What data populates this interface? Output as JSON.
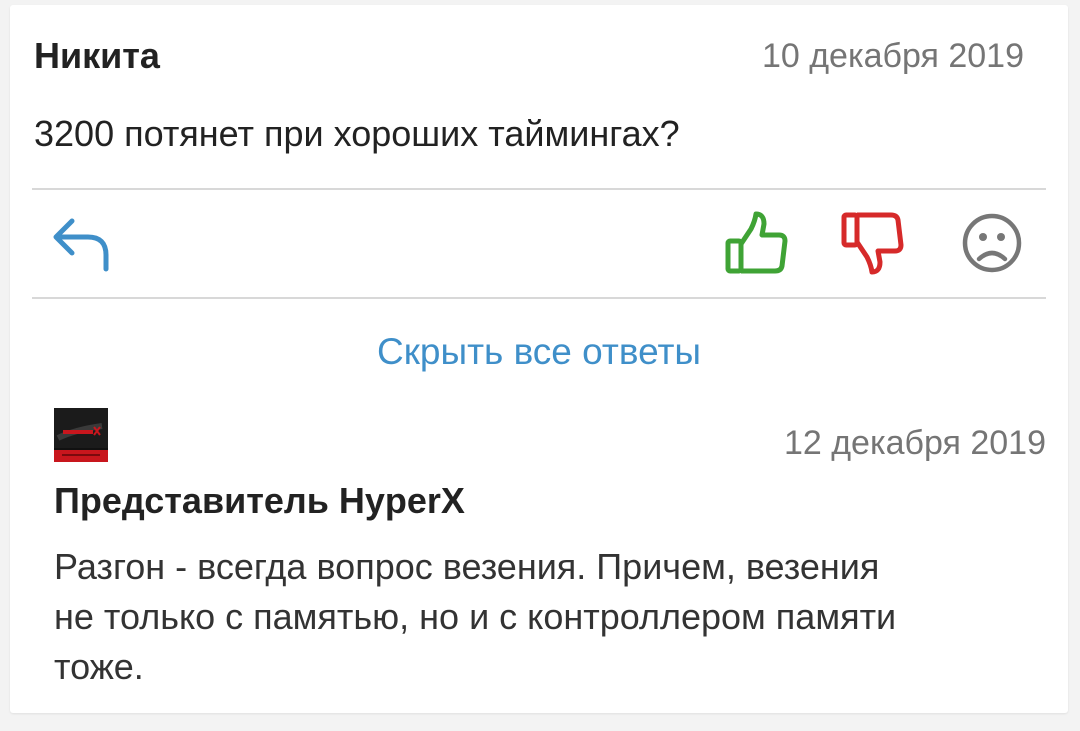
{
  "comment": {
    "author": "Никита",
    "date": "10 декабря 2019",
    "text": "3200 потянет при хороших таймингах?"
  },
  "actions": {
    "reply_icon": "reply-icon",
    "like_icon": "thumbs-up-icon",
    "dislike_icon": "thumbs-down-icon",
    "sad_icon": "sad-face-icon",
    "colors": {
      "reply": "#3f8fc9",
      "like": "#3fa335",
      "dislike": "#d62a2a",
      "sad": "#777777"
    }
  },
  "replies_toggle": {
    "label": "Скрыть все ответы"
  },
  "reply": {
    "avatar_icon": "hyperx-avatar-icon",
    "date": "12 декабря 2019",
    "author": "Представитель HyperX",
    "text": "Разгон - всегда вопрос везения. Причем, везения не только с памятью, но и с контроллером памяти тоже."
  }
}
